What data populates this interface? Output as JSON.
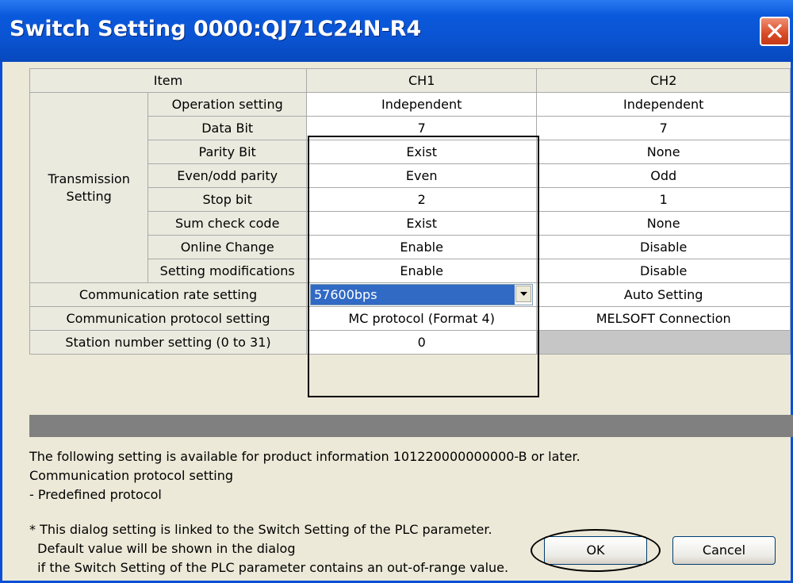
{
  "window": {
    "title": "Switch Setting 0000:QJ71C24N-R4",
    "close_glyph": "✕",
    "close_icon": "close-icon"
  },
  "table": {
    "headers": {
      "item": "Item",
      "ch1": "CH1",
      "ch2": "CH2"
    },
    "transmission_group_label_line1": "Transmission",
    "transmission_group_label_line2": "Setting",
    "transmission_rows": [
      {
        "label": "Operation setting",
        "ch1": "Independent",
        "ch2": "Independent"
      },
      {
        "label": "Data Bit",
        "ch1": "7",
        "ch2": "7"
      },
      {
        "label": "Parity Bit",
        "ch1": "Exist",
        "ch2": "None"
      },
      {
        "label": "Even/odd parity",
        "ch1": "Even",
        "ch2": "Odd"
      },
      {
        "label": "Stop bit",
        "ch1": "2",
        "ch2": "1"
      },
      {
        "label": "Sum check code",
        "ch1": "Exist",
        "ch2": "None"
      },
      {
        "label": "Online Change",
        "ch1": "Enable",
        "ch2": "Disable"
      },
      {
        "label": "Setting modifications",
        "ch1": "Enable",
        "ch2": "Disable"
      }
    ],
    "comm_rate": {
      "label": "Communication rate setting",
      "ch1_selected": "57600bps",
      "ch2": "Auto Setting"
    },
    "comm_protocol": {
      "label": "Communication protocol setting",
      "ch1": "MC protocol (Format 4)",
      "ch2": "MELSOFT Connection"
    },
    "station_number": {
      "label": "Station number setting (0 to 31)",
      "ch1": "0",
      "ch2": ""
    }
  },
  "notes": {
    "line1": "The following setting is available for product information 101220000000000-B or later.",
    "line2": "Communication protocol setting",
    "line3": "- Predefined protocol",
    "line4": "* This dialog setting is linked to the Switch Setting of the PLC parameter.",
    "line5": "  Default value will be shown in the dialog",
    "line6": "  if the Switch Setting of the PLC parameter contains an out-of-range value."
  },
  "buttons": {
    "ok": "OK",
    "cancel": "Cancel"
  },
  "colors": {
    "titlebar": "#0a54d3",
    "dialog_bg": "#ece9d8",
    "selection": "#316ac5",
    "disabled_cell": "#c6c6c6",
    "status_bar": "#808080"
  }
}
